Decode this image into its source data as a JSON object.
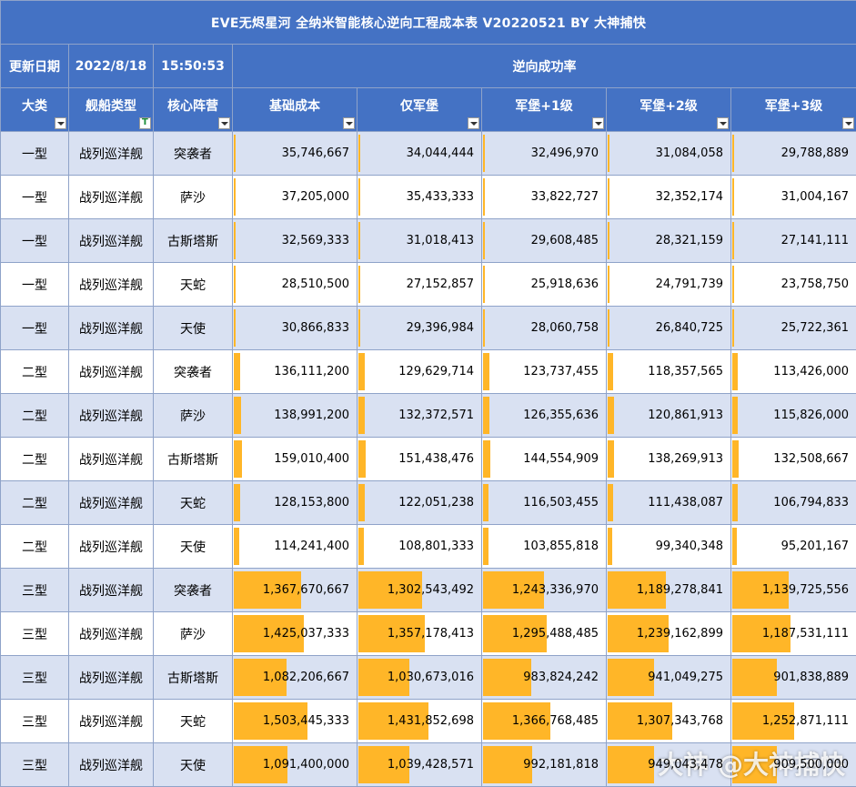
{
  "title": "EVE无烬星河 全纳米智能核心逆向工程成本表 V20220521 BY 大神捕快",
  "update_label": "更新日期",
  "update_date": "2022/8/18",
  "update_time": "15:50:53",
  "success_rate_label": "逆向成功率",
  "headers": {
    "category": "大类",
    "ship_type": "舰船类型",
    "core_faction": "核心阵营",
    "base_cost": "基础成本",
    "fort_only": "仅军堡",
    "fort_1": "军堡+1级",
    "fort_2": "军堡+2级",
    "fort_3": "军堡+3级"
  },
  "bar_scale_max": 2500000000,
  "rows": [
    {
      "cat": "一型",
      "ship": "战列巡洋舰",
      "faction": "突袭者",
      "v": [
        35746667,
        34044444,
        32496970,
        31084058,
        29788889
      ],
      "s": [
        "35,746,667",
        "34,044,444",
        "32,496,970",
        "31,084,058",
        "29,788,889"
      ]
    },
    {
      "cat": "一型",
      "ship": "战列巡洋舰",
      "faction": "萨沙",
      "v": [
        37205000,
        35433333,
        33822727,
        32352174,
        31004167
      ],
      "s": [
        "37,205,000",
        "35,433,333",
        "33,822,727",
        "32,352,174",
        "31,004,167"
      ]
    },
    {
      "cat": "一型",
      "ship": "战列巡洋舰",
      "faction": "古斯塔斯",
      "v": [
        32569333,
        31018413,
        29608485,
        28321159,
        27141111
      ],
      "s": [
        "32,569,333",
        "31,018,413",
        "29,608,485",
        "28,321,159",
        "27,141,111"
      ]
    },
    {
      "cat": "一型",
      "ship": "战列巡洋舰",
      "faction": "天蛇",
      "v": [
        28510500,
        27152857,
        25918636,
        24791739,
        23758750
      ],
      "s": [
        "28,510,500",
        "27,152,857",
        "25,918,636",
        "24,791,739",
        "23,758,750"
      ]
    },
    {
      "cat": "一型",
      "ship": "战列巡洋舰",
      "faction": "天使",
      "v": [
        30866833,
        29396984,
        28060758,
        26840725,
        25722361
      ],
      "s": [
        "30,866,833",
        "29,396,984",
        "28,060,758",
        "26,840,725",
        "25,722,361"
      ]
    },
    {
      "cat": "二型",
      "ship": "战列巡洋舰",
      "faction": "突袭者",
      "v": [
        136111200,
        129629714,
        123737455,
        118357565,
        113426000
      ],
      "s": [
        "136,111,200",
        "129,629,714",
        "123,737,455",
        "118,357,565",
        "113,426,000"
      ]
    },
    {
      "cat": "二型",
      "ship": "战列巡洋舰",
      "faction": "萨沙",
      "v": [
        138991200,
        132372571,
        126355636,
        120861913,
        115826000
      ],
      "s": [
        "138,991,200",
        "132,372,571",
        "126,355,636",
        "120,861,913",
        "115,826,000"
      ]
    },
    {
      "cat": "二型",
      "ship": "战列巡洋舰",
      "faction": "古斯塔斯",
      "v": [
        159010400,
        151438476,
        144554909,
        138269913,
        132508667
      ],
      "s": [
        "159,010,400",
        "151,438,476",
        "144,554,909",
        "138,269,913",
        "132,508,667"
      ]
    },
    {
      "cat": "二型",
      "ship": "战列巡洋舰",
      "faction": "天蛇",
      "v": [
        128153800,
        122051238,
        116503455,
        111438087,
        106794833
      ],
      "s": [
        "128,153,800",
        "122,051,238",
        "116,503,455",
        "111,438,087",
        "106,794,833"
      ]
    },
    {
      "cat": "二型",
      "ship": "战列巡洋舰",
      "faction": "天使",
      "v": [
        114241400,
        108801333,
        103855818,
        99340348,
        95201167
      ],
      "s": [
        "114,241,400",
        "108,801,333",
        "103,855,818",
        "99,340,348",
        "95,201,167"
      ]
    },
    {
      "cat": "三型",
      "ship": "战列巡洋舰",
      "faction": "突袭者",
      "v": [
        1367670667,
        1302543492,
        1243336970,
        1189278841,
        1139725556
      ],
      "s": [
        "1,367,670,667",
        "1,302,543,492",
        "1,243,336,970",
        "1,189,278,841",
        "1,139,725,556"
      ]
    },
    {
      "cat": "三型",
      "ship": "战列巡洋舰",
      "faction": "萨沙",
      "v": [
        1425037333,
        1357178413,
        1295488485,
        1239162899,
        1187531111
      ],
      "s": [
        "1,425,037,333",
        "1,357,178,413",
        "1,295,488,485",
        "1,239,162,899",
        "1,187,531,111"
      ]
    },
    {
      "cat": "三型",
      "ship": "战列巡洋舰",
      "faction": "古斯塔斯",
      "v": [
        1082206667,
        1030673016,
        983824242,
        941049275,
        901838889
      ],
      "s": [
        "1,082,206,667",
        "1,030,673,016",
        "983,824,242",
        "941,049,275",
        "901,838,889"
      ]
    },
    {
      "cat": "三型",
      "ship": "战列巡洋舰",
      "faction": "天蛇",
      "v": [
        1503445333,
        1431852698,
        1366768485,
        1307343768,
        1252871111
      ],
      "s": [
        "1,503,445,333",
        "1,431,852,698",
        "1,366,768,485",
        "1,307,343,768",
        "1,252,871,111"
      ]
    },
    {
      "cat": "三型",
      "ship": "战列巡洋舰",
      "faction": "天使",
      "v": [
        1091400000,
        1039428571,
        992181818,
        949043478,
        909500000
      ],
      "s": [
        "1,091,400,000",
        "1,039,428,571",
        "992,181,818",
        "949,043,478",
        "909,500,000"
      ]
    }
  ],
  "watermark": "大神 @大神捕快",
  "colors": {
    "header_blue": "#4472c4",
    "band_light": "#d9e1f2",
    "bar_orange": "#ffb628",
    "grid": "#8fa3c9"
  }
}
